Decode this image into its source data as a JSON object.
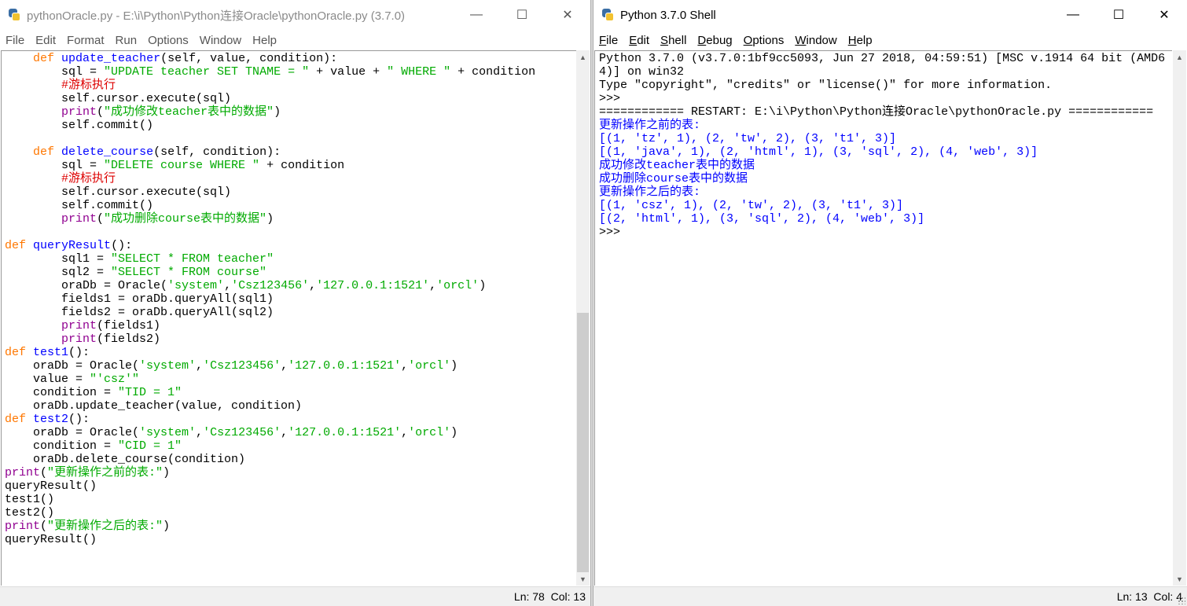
{
  "editor": {
    "title": "pythonOracle.py - E:\\i\\Python\\Python连接Oracle\\pythonOracle.py (3.7.0)",
    "menu": [
      "File",
      "Edit",
      "Format",
      "Run",
      "Options",
      "Window",
      "Help"
    ],
    "status": {
      "ln": "Ln: 78",
      "col": "Col: 13"
    },
    "lines": [
      [
        [
          "    ",
          ""
        ],
        [
          "def",
          "kw"
        ],
        [
          " ",
          ""
        ],
        [
          "update_teacher",
          "fn"
        ],
        [
          "(self, value, condition):",
          ""
        ]
      ],
      [
        [
          "        sql = ",
          ""
        ],
        [
          "\"UPDATE teacher SET TNAME = \"",
          "st"
        ],
        [
          " + value + ",
          ""
        ],
        [
          "\" WHERE \"",
          "st"
        ],
        [
          " + condition",
          ""
        ]
      ],
      [
        [
          "        ",
          ""
        ],
        [
          "#游标执行",
          "cm"
        ]
      ],
      [
        [
          "        self.cursor.execute(sql)",
          ""
        ]
      ],
      [
        [
          "        ",
          ""
        ],
        [
          "print",
          "bi"
        ],
        [
          "(",
          ""
        ],
        [
          "\"成功修改teacher表中的数据\"",
          "st"
        ],
        [
          ")",
          ""
        ]
      ],
      [
        [
          "        self.commit()",
          ""
        ]
      ],
      [
        [
          "",
          ""
        ]
      ],
      [
        [
          "    ",
          ""
        ],
        [
          "def",
          "kw"
        ],
        [
          " ",
          ""
        ],
        [
          "delete_course",
          "fn"
        ],
        [
          "(self, condition):",
          ""
        ]
      ],
      [
        [
          "        sql = ",
          ""
        ],
        [
          "\"DELETE course WHERE \"",
          "st"
        ],
        [
          " + condition",
          ""
        ]
      ],
      [
        [
          "        ",
          ""
        ],
        [
          "#游标执行",
          "cm"
        ]
      ],
      [
        [
          "        self.cursor.execute(sql)",
          ""
        ]
      ],
      [
        [
          "        self.commit()",
          ""
        ]
      ],
      [
        [
          "        ",
          ""
        ],
        [
          "print",
          "bi"
        ],
        [
          "(",
          ""
        ],
        [
          "\"成功删除course表中的数据\"",
          "st"
        ],
        [
          ")",
          ""
        ]
      ],
      [
        [
          "",
          ""
        ]
      ],
      [
        [
          "def",
          "kw"
        ],
        [
          " ",
          ""
        ],
        [
          "queryResult",
          "fn"
        ],
        [
          "():",
          ""
        ]
      ],
      [
        [
          "        sql1 = ",
          ""
        ],
        [
          "\"SELECT * FROM teacher\"",
          "st"
        ]
      ],
      [
        [
          "        sql2 = ",
          ""
        ],
        [
          "\"SELECT * FROM course\"",
          "st"
        ]
      ],
      [
        [
          "        oraDb = Oracle(",
          ""
        ],
        [
          "'system'",
          "st"
        ],
        [
          ",",
          ""
        ],
        [
          "'Csz123456'",
          "st"
        ],
        [
          ",",
          ""
        ],
        [
          "'127.0.0.1:1521'",
          "st"
        ],
        [
          ",",
          ""
        ],
        [
          "'orcl'",
          "st"
        ],
        [
          ")",
          ""
        ]
      ],
      [
        [
          "        fields1 = oraDb.queryAll(sql1)",
          ""
        ]
      ],
      [
        [
          "        fields2 = oraDb.queryAll(sql2)",
          ""
        ]
      ],
      [
        [
          "        ",
          ""
        ],
        [
          "print",
          "bi"
        ],
        [
          "(fields1)",
          ""
        ]
      ],
      [
        [
          "        ",
          ""
        ],
        [
          "print",
          "bi"
        ],
        [
          "(fields2)",
          ""
        ]
      ],
      [
        [
          "def",
          "kw"
        ],
        [
          " ",
          ""
        ],
        [
          "test1",
          "fn"
        ],
        [
          "():",
          ""
        ]
      ],
      [
        [
          "    oraDb = Oracle(",
          ""
        ],
        [
          "'system'",
          "st"
        ],
        [
          ",",
          ""
        ],
        [
          "'Csz123456'",
          "st"
        ],
        [
          ",",
          ""
        ],
        [
          "'127.0.0.1:1521'",
          "st"
        ],
        [
          ",",
          ""
        ],
        [
          "'orcl'",
          "st"
        ],
        [
          ")",
          ""
        ]
      ],
      [
        [
          "    value = ",
          ""
        ],
        [
          "\"'csz'\"",
          "st"
        ]
      ],
      [
        [
          "    condition = ",
          ""
        ],
        [
          "\"TID = 1\"",
          "st"
        ]
      ],
      [
        [
          "    oraDb.update_teacher(value, condition)",
          ""
        ]
      ],
      [
        [
          "def",
          "kw"
        ],
        [
          " ",
          ""
        ],
        [
          "test2",
          "fn"
        ],
        [
          "():",
          ""
        ]
      ],
      [
        [
          "    oraDb = Oracle(",
          ""
        ],
        [
          "'system'",
          "st"
        ],
        [
          ",",
          ""
        ],
        [
          "'Csz123456'",
          "st"
        ],
        [
          ",",
          ""
        ],
        [
          "'127.0.0.1:1521'",
          "st"
        ],
        [
          ",",
          ""
        ],
        [
          "'orcl'",
          "st"
        ],
        [
          ")",
          ""
        ]
      ],
      [
        [
          "    condition = ",
          ""
        ],
        [
          "\"CID = 1\"",
          "st"
        ]
      ],
      [
        [
          "    oraDb.delete_course(condition)",
          ""
        ]
      ],
      [
        [
          "print",
          "bi"
        ],
        [
          "(",
          ""
        ],
        [
          "\"更新操作之前的表:\"",
          "st"
        ],
        [
          ")",
          ""
        ]
      ],
      [
        [
          "queryResult()",
          ""
        ]
      ],
      [
        [
          "test1()",
          ""
        ]
      ],
      [
        [
          "test2()",
          ""
        ]
      ],
      [
        [
          "print",
          "bi"
        ],
        [
          "(",
          ""
        ],
        [
          "\"更新操作之后的表:\"",
          "st"
        ],
        [
          ")",
          ""
        ]
      ],
      [
        [
          "queryResult()",
          ""
        ]
      ]
    ],
    "scroll_thumb": {
      "position": 0.49,
      "size": 0.51
    }
  },
  "shell": {
    "title": "Python 3.7.0 Shell",
    "menu": [
      {
        "u": "F",
        "rest": "ile"
      },
      {
        "u": "E",
        "rest": "dit"
      },
      {
        "u": "S",
        "rest": "hell"
      },
      {
        "u": "D",
        "rest": "ebug"
      },
      {
        "u": "O",
        "rest": "ptions"
      },
      {
        "u": "W",
        "rest": "indow"
      },
      {
        "u": "H",
        "rest": "elp"
      }
    ],
    "status": {
      "ln": "Ln: 13",
      "col": "Col: 4"
    },
    "lines": [
      [
        [
          "Python 3.7.0 (v3.7.0:1bf9cc5093, Jun 27 2018, 04:59:51) [MSC v.1914 64 bit (AMD6",
          ""
        ]
      ],
      [
        [
          "4)] on win32",
          ""
        ]
      ],
      [
        [
          "Type \"copyright\", \"credits\" or \"license()\" for more information.",
          ""
        ]
      ],
      [
        [
          ">>> ",
          ""
        ]
      ],
      [
        [
          "============ RESTART: E:\\i\\Python\\Python连接Oracle\\pythonOracle.py ============",
          ""
        ]
      ],
      [
        [
          "更新操作之前的表:",
          "out"
        ]
      ],
      [
        [
          "[(1, 'tz', 1), (2, 'tw', 2), (3, 't1', 3)]",
          "out"
        ]
      ],
      [
        [
          "[(1, 'java', 1), (2, 'html', 1), (3, 'sql', 2), (4, 'web', 3)]",
          "out"
        ]
      ],
      [
        [
          "成功修改teacher表中的数据",
          "out"
        ]
      ],
      [
        [
          "成功删除course表中的数据",
          "out"
        ]
      ],
      [
        [
          "更新操作之后的表:",
          "out"
        ]
      ],
      [
        [
          "[(1, 'csz', 1), (2, 'tw', 2), (3, 't1', 3)]",
          "out"
        ]
      ],
      [
        [
          "[(2, 'html', 1), (3, 'sql', 2), (4, 'web', 3)]",
          "out"
        ]
      ],
      [
        [
          ">>> ",
          ""
        ]
      ]
    ]
  },
  "window_controls": {
    "minimize": "—",
    "maximize": "☐",
    "close": "✕"
  }
}
